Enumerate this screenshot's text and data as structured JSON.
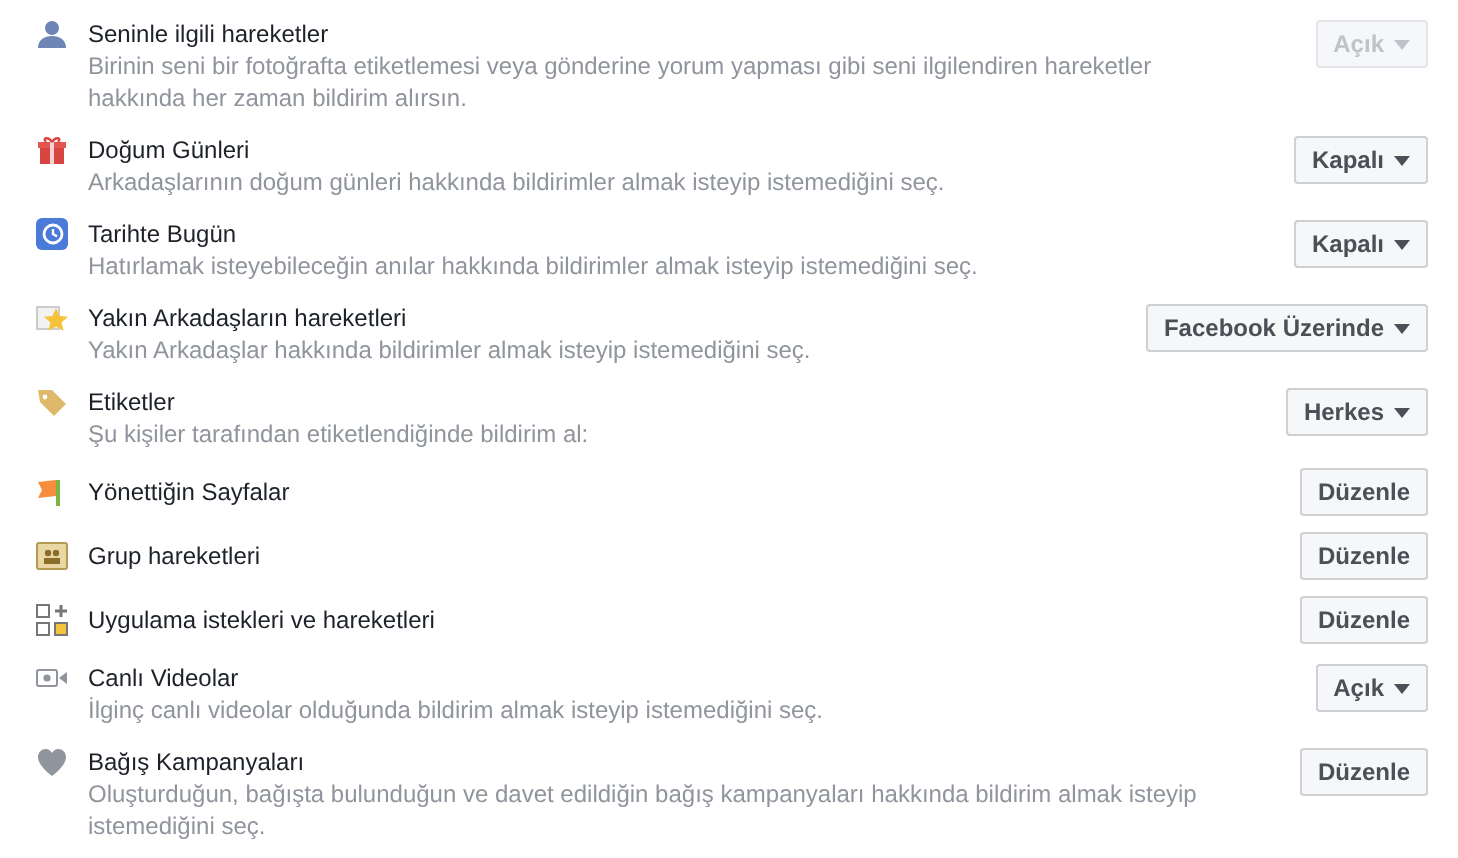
{
  "rows": [
    {
      "title": "Seninle ilgili hareketler",
      "description": "Birinin seni bir fotoğrafta etiketlemesi veya gönderine yorum yapması gibi seni ilgilendiren hareketler hakkında her zaman bildirim alırsın.",
      "control": {
        "kind": "dropdown",
        "label": "Açık",
        "disabled": true
      }
    },
    {
      "title": "Doğum Günleri",
      "description": "Arkadaşlarının doğum günleri hakkında bildirimler almak isteyip istemediğini seç.",
      "control": {
        "kind": "dropdown",
        "label": "Kapalı",
        "disabled": false
      }
    },
    {
      "title": "Tarihte Bugün",
      "description": "Hatırlamak isteyebileceğin anılar hakkında bildirimler almak isteyip istemediğini seç.",
      "control": {
        "kind": "dropdown",
        "label": "Kapalı",
        "disabled": false
      }
    },
    {
      "title": "Yakın Arkadaşların hareketleri",
      "description": "Yakın Arkadaşlar hakkında bildirimler almak isteyip istemediğini seç.",
      "control": {
        "kind": "dropdown",
        "label": "Facebook Üzerinde",
        "disabled": false
      }
    },
    {
      "title": "Etiketler",
      "description": "Şu kişiler tarafından etiketlendiğinde bildirim al:",
      "control": {
        "kind": "dropdown",
        "label": "Herkes",
        "disabled": false
      }
    },
    {
      "title": "Yönettiğin Sayfalar",
      "control": {
        "kind": "button",
        "label": "Düzenle",
        "disabled": false
      }
    },
    {
      "title": "Grup hareketleri",
      "control": {
        "kind": "button",
        "label": "Düzenle",
        "disabled": false
      }
    },
    {
      "title": "Uygulama istekleri ve hareketleri",
      "control": {
        "kind": "button",
        "label": "Düzenle",
        "disabled": false
      }
    },
    {
      "title": "Canlı Videolar",
      "description": "İlginç canlı videolar olduğunda bildirim almak isteyip istemediğini seç.",
      "control": {
        "kind": "dropdown",
        "label": "Açık",
        "disabled": false
      }
    },
    {
      "title": "Bağış Kampanyaları",
      "description": "Oluşturduğun, bağışta bulunduğun ve davet edildiğin bağış kampanyaları hakkında bildirim almak isteyip istemediğini seç.",
      "control": {
        "kind": "button",
        "label": "Düzenle",
        "disabled": false
      }
    }
  ]
}
